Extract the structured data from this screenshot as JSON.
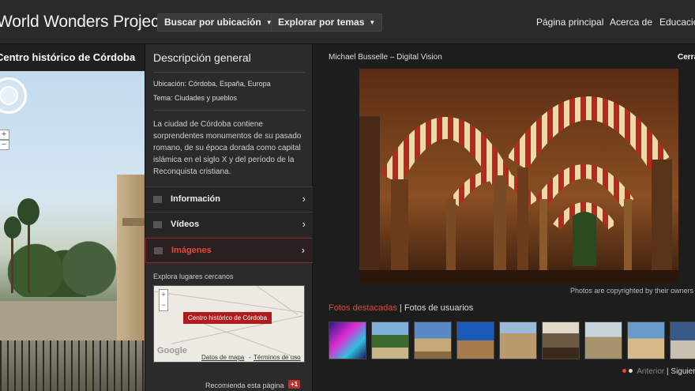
{
  "header": {
    "brand": "World Wonders Project",
    "nav_location": "Buscar por ubicación",
    "nav_topics": "Explorar por temas",
    "links": [
      "Página principal",
      "Acerca de",
      "Educación"
    ]
  },
  "streetview": {
    "title": "Centro histórico de Córdoba"
  },
  "panel": {
    "title": "Descripción general",
    "location": "Ubicación: Córdoba, España, Europa",
    "theme": "Tema: Ciudades y pueblos",
    "description": "La ciudad de Córdoba contiene sorprendentes monumentos de su pasado romano, de su época dorada como capital islámica en el siglo X y del período de la Reconquista cristiana.",
    "menu": [
      {
        "label": "Información",
        "active": false
      },
      {
        "label": "Vídeos",
        "active": false
      },
      {
        "label": "Imágenes",
        "active": true
      }
    ],
    "nearby_label": "Explora lugares cercanos",
    "map": {
      "pin_label": "Centro histórico de Córdoba",
      "google": "Google",
      "data_link": "Datos de mapa",
      "separator": " - ",
      "terms_link": "Términos de uso"
    },
    "recommend": "Recomienda esta página",
    "gplus": "+1"
  },
  "viewer": {
    "credit": "Michael Busselle – Digital Vision",
    "close": "Cerrar",
    "copyright": "Photos are copyrighted by their owners",
    "tab_featured": "Fotos destacadas",
    "tab_separator": " | ",
    "tab_users": "Fotos de usuarios",
    "pager_prev": "Anterior",
    "pager_sep": " | ",
    "pager_next": "Siguiente"
  },
  "colors": {
    "accent": "#e04a3a",
    "topbar": "#2a2a2a",
    "panel": "#2b2b2b"
  }
}
